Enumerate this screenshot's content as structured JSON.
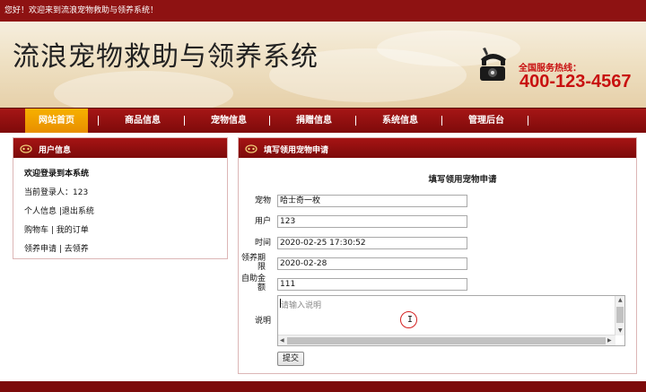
{
  "top_bar": {
    "welcome": "您好！欢迎来到流浪宠物救助与领养系统！"
  },
  "header": {
    "site_title": "流浪宠物救助与领养系统",
    "hotline_label": "全国服务热线：",
    "hotline_number": "400-123-4567"
  },
  "nav": {
    "items": [
      {
        "label": "网站首页",
        "active": true
      },
      {
        "label": "商品信息"
      },
      {
        "label": "宠物信息"
      },
      {
        "label": "捐赠信息"
      },
      {
        "label": "系统信息"
      },
      {
        "label": "管理后台"
      }
    ]
  },
  "user_panel": {
    "title": "用户信息",
    "welcome": "欢迎登录到本系统",
    "current_user": "当前登录人：123",
    "links_line1": "个人信息 |退出系统",
    "links_line2": "购物车 | 我的订单",
    "links_line3": "领养申请 | 去领养"
  },
  "form_panel": {
    "title": "填写领用宠物申请",
    "form_heading": "填写领用宠物申请",
    "fields": [
      {
        "label": "宠物",
        "value": "哈士奇一枚"
      },
      {
        "label": "用户",
        "value": "123"
      },
      {
        "label": "时间",
        "value": "2020-02-25 17:30:52"
      },
      {
        "label": "领养期限",
        "value": "2020-02-28"
      },
      {
        "label": "自助金额",
        "value": "111"
      }
    ],
    "desc_label": "说明",
    "desc_placeholder": "请输入说明",
    "submit_label": "提交"
  },
  "colors": {
    "brand_red": "#8e1212",
    "nav_active": "#f0a000",
    "hotline_red": "#c81010"
  }
}
